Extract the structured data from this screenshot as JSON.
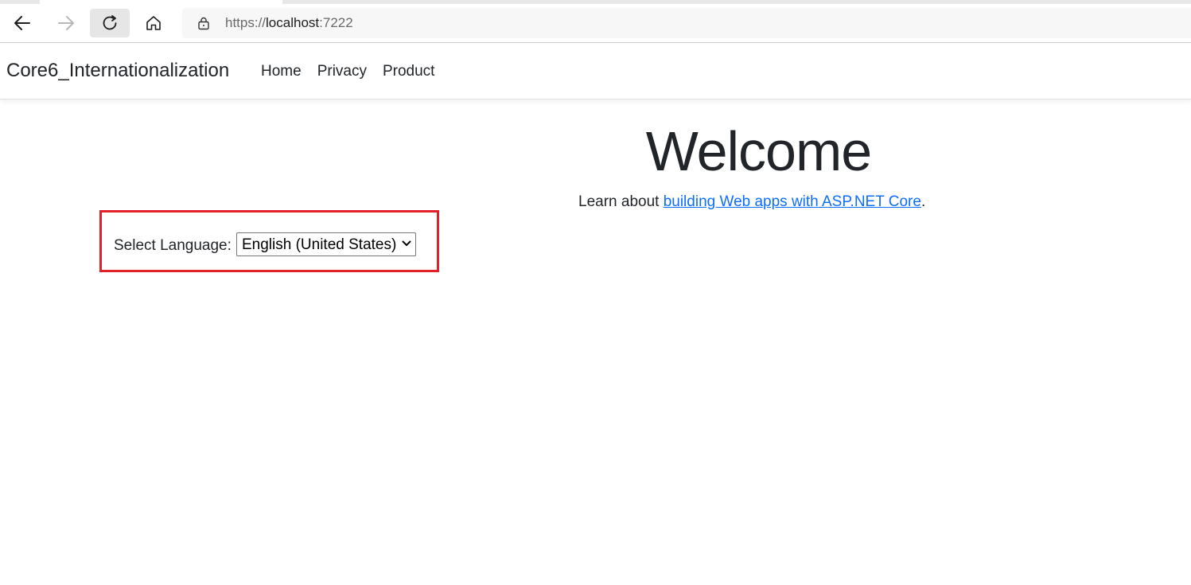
{
  "browser": {
    "url_scheme": "https://",
    "url_host": "localhost",
    "url_port": ":7222"
  },
  "navbar": {
    "brand": "Core6_Internationalization",
    "links": [
      "Home",
      "Privacy",
      "Product"
    ]
  },
  "main": {
    "heading": "Welcome",
    "learn_prefix": "Learn about ",
    "learn_link": "building Web apps with ASP.NET Core",
    "learn_suffix": "."
  },
  "language": {
    "label": "Select Language:",
    "selected": "English (United States)"
  },
  "colors": {
    "highlight_border": "#e3202a",
    "link": "#0d6efd"
  },
  "icons": {
    "back": "back-arrow-icon",
    "forward": "forward-arrow-icon",
    "reload": "reload-icon",
    "home": "home-icon",
    "lock": "lock-icon",
    "select": "chevron-down-icon"
  }
}
